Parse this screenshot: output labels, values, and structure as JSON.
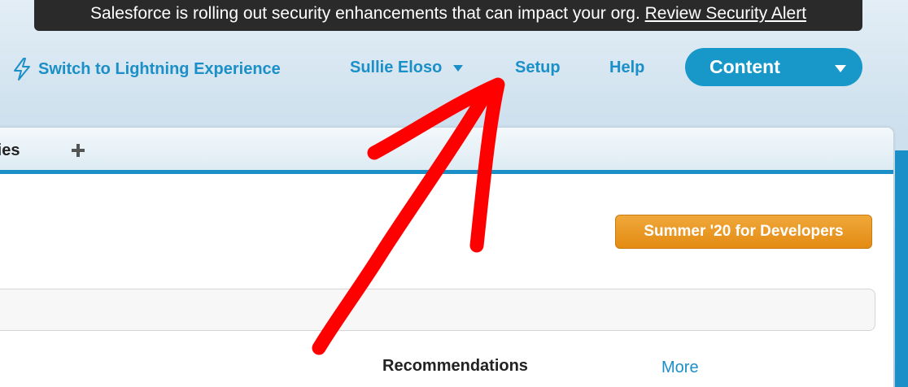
{
  "alert": {
    "message": "Salesforce is rolling out security enhancements that can impact your org.",
    "link": "Review Security Alert"
  },
  "nav": {
    "lightning": "Switch to Lightning Experience",
    "user": "Sullie Eloso",
    "setup": "Setup",
    "help": "Help",
    "content_button": "Content"
  },
  "tabs": {
    "partial_tab": "ties"
  },
  "main": {
    "release_button": "Summer '20 for Developers",
    "recommendations_heading": "Recommendations",
    "more_link": "More"
  },
  "colors": {
    "link": "#1b8fc7",
    "alert_bg": "#2a2a2a",
    "release_button": "#e38b13",
    "annotation_arrow": "#ff0000"
  },
  "icons": {
    "lightning": "lightning-bolt-icon",
    "user_caret": "chevron-down-icon",
    "content_caret": "chevron-down-icon",
    "add_tab": "plus-icon"
  }
}
